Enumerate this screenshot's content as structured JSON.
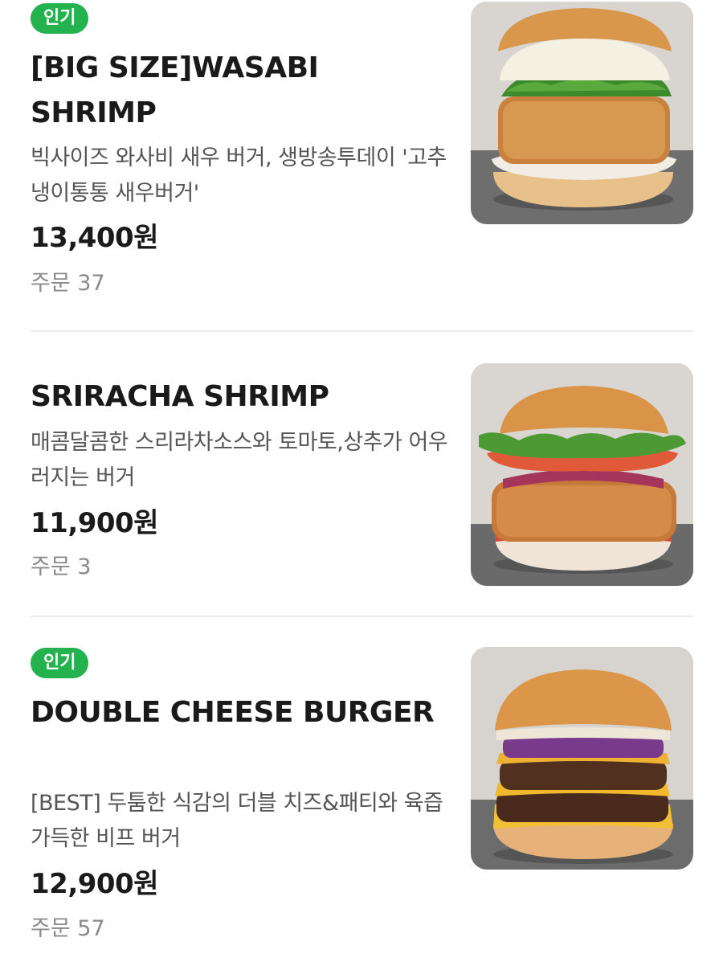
{
  "menu_items": [
    {
      "badge": "인기",
      "name": "[BIG SIZE]WASABI SHRIMP",
      "description": "빅사이즈 와사비 새우 버거, 생방송투데이 '고추냉이통통 새우버거'",
      "price": "13,400원",
      "orders_label": "주문 37",
      "image_icon": "wasabi-shrimp-burger-photo"
    },
    {
      "badge": "",
      "name": "SRIRACHA SHRIMP",
      "description": "매콤달콤한 스리라차소스와 토마토,상추가 어우러지는 버거",
      "price": "11,900원",
      "orders_label": "주문 3",
      "image_icon": "sriracha-shrimp-burger-photo"
    },
    {
      "badge": "인기",
      "name": "DOUBLE CHEESE BURGER",
      "description": "[BEST] 두툼한 식감의 더블 치즈&패티와 육즙 가득한 비프 버거",
      "price": "12,900원",
      "orders_label": "주문 57",
      "image_icon": "double-cheese-burger-photo"
    }
  ],
  "colors": {
    "badge_bg": "#24b24f",
    "badge_text": "#ffffff",
    "title_text": "#1a1a1a",
    "description_text": "#555555",
    "orders_text": "#8a8a8a",
    "divider": "#ebebeb"
  }
}
